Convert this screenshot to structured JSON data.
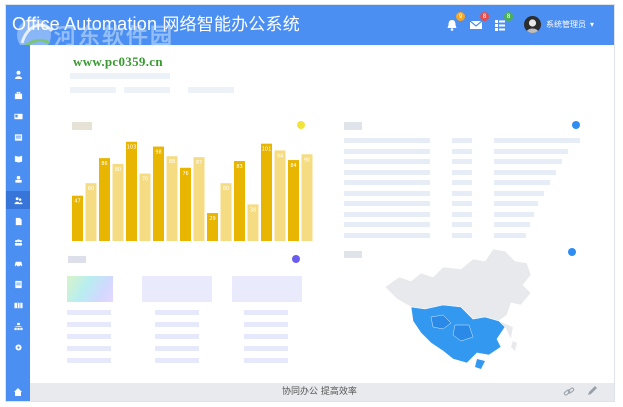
{
  "header": {
    "brand_en": "Office Automation",
    "brand_cn": "网络智能办公系统",
    "notifications": [
      {
        "icon": "bell-icon",
        "count": "9",
        "color": "#f5a623"
      },
      {
        "icon": "mail-icon",
        "count": "8",
        "color": "#e64c4c"
      },
      {
        "icon": "tasks-icon",
        "count": "8",
        "color": "#4caf50"
      }
    ],
    "user_name": "系统管理员",
    "user_menu_icon": "chevron-down-icon"
  },
  "watermark": {
    "site": "河东软件园",
    "url": "www.pc0359.cn"
  },
  "sidebar": {
    "items": [
      {
        "icon": "user-icon"
      },
      {
        "icon": "briefcase-icon"
      },
      {
        "icon": "id-card-icon"
      },
      {
        "icon": "inbox-icon"
      },
      {
        "icon": "book-icon"
      },
      {
        "icon": "stamp-icon"
      },
      {
        "icon": "group-icon",
        "active": true
      },
      {
        "icon": "file-icon"
      },
      {
        "icon": "team-icon"
      },
      {
        "icon": "car-icon"
      },
      {
        "icon": "document-icon"
      },
      {
        "icon": "grid-icon"
      },
      {
        "icon": "org-chart-icon"
      },
      {
        "icon": "settings-icon"
      }
    ],
    "home_icon": "home-icon"
  },
  "chart_data": {
    "type": "bar",
    "values": [
      47,
      60,
      86,
      80,
      103,
      70,
      98,
      88,
      76,
      87,
      29,
      60,
      83,
      38,
      101,
      94,
      84,
      90
    ],
    "colors": [
      "#e8b500",
      "#f5dc82"
    ],
    "accent_dot": "#f2e33a"
  },
  "panels": {
    "chart_dot_color": "#f2e33a",
    "list_dot_color": "#2f8cf0",
    "purple_dot_color": "#6b5cf0",
    "map_dot_color": "#2f8cf0"
  },
  "footer": {
    "text": "协同办公  提高效率",
    "link_icon": "link-icon",
    "edit_icon": "pencil-icon"
  }
}
